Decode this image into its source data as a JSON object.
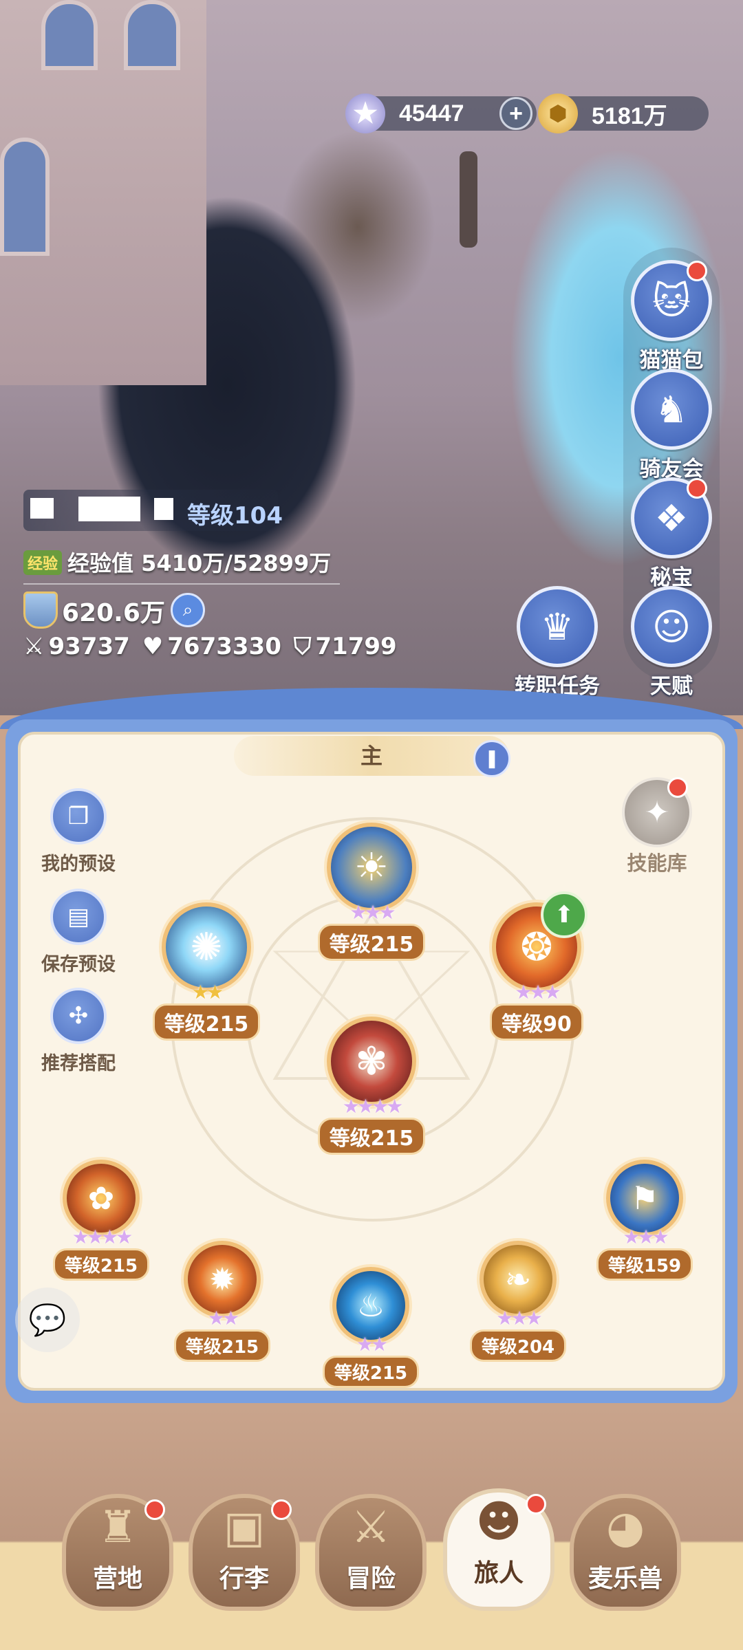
{
  "currency": {
    "stars": "45447",
    "plus": "+",
    "coins": "5181万"
  },
  "side_buttons": [
    {
      "label": "猫猫包",
      "badge": true
    },
    {
      "label": "骑友会",
      "badge": false
    },
    {
      "label": "秘宝",
      "badge": true
    },
    {
      "label": "天赋",
      "badge": false
    }
  ],
  "job_task": {
    "label": "转职任务"
  },
  "player": {
    "level": "等级104",
    "exp_tag": "经验",
    "exp": "经验值 5410万/52899万",
    "power": "620.6万",
    "attack": "93737",
    "hp": "7673330",
    "defense": "71799"
  },
  "panel": {
    "tab": "主",
    "left_buttons": [
      "我的预设",
      "保存预设",
      "推荐搭配"
    ],
    "skill_library": "技能库"
  },
  "skills": [
    {
      "level": "等级215",
      "stars": 3
    },
    {
      "level": "等级215",
      "stars": 2
    },
    {
      "level": "等级90",
      "stars": 3
    },
    {
      "level": "等级215",
      "stars": 4
    },
    {
      "level": "等级215",
      "stars": 4
    },
    {
      "level": "等级215",
      "stars": 2
    },
    {
      "level": "等级215",
      "stars": 2
    },
    {
      "level": "等级204",
      "stars": 3
    },
    {
      "level": "等级159",
      "stars": 3
    }
  ],
  "bottom_nav": [
    {
      "label": "营地",
      "badge": true
    },
    {
      "label": "行李",
      "badge": true
    },
    {
      "label": "冒险",
      "badge": false
    },
    {
      "label": "旅人",
      "badge": true,
      "active": true
    },
    {
      "label": "麦乐兽",
      "badge": false
    }
  ]
}
